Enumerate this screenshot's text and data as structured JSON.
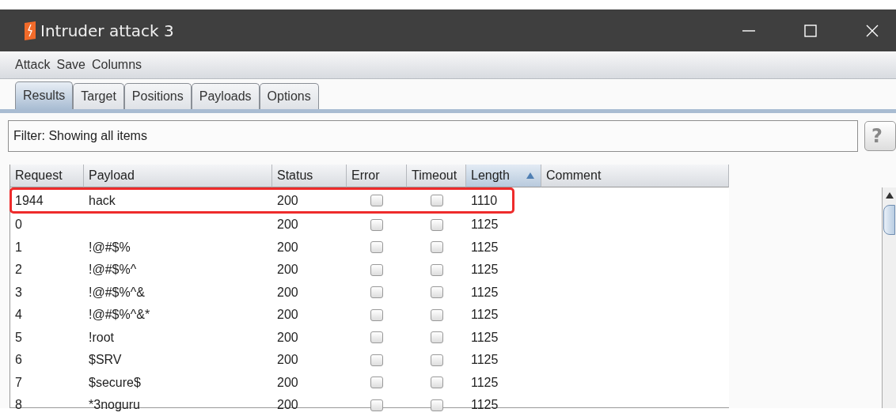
{
  "window": {
    "title": "Intruder attack 3"
  },
  "menu": [
    "Attack",
    "Save",
    "Columns"
  ],
  "tabs": [
    {
      "label": "Results",
      "selected": true
    },
    {
      "label": "Target",
      "selected": false
    },
    {
      "label": "Positions",
      "selected": false
    },
    {
      "label": "Payloads",
      "selected": false
    },
    {
      "label": "Options",
      "selected": false
    }
  ],
  "filter": {
    "value": "Filter: Showing all items",
    "help": "?"
  },
  "table": {
    "columns": [
      {
        "label": "Request",
        "sorted": false
      },
      {
        "label": "Payload",
        "sorted": false
      },
      {
        "label": "Status",
        "sorted": false
      },
      {
        "label": "Error",
        "sorted": false
      },
      {
        "label": "Timeout",
        "sorted": false
      },
      {
        "label": "Length",
        "sorted": true
      },
      {
        "label": "Comment",
        "sorted": false
      }
    ],
    "rows": [
      {
        "request": "1944",
        "payload": "hack",
        "status": "200",
        "error": false,
        "timeout": false,
        "length": "1110",
        "highlighted": true
      },
      {
        "request": "0",
        "status": "200",
        "error": false,
        "timeout": false,
        "length": "1125",
        "highlighted": false
      },
      {
        "request": "1",
        "payload": "!@#$%",
        "status": "200",
        "error": false,
        "timeout": false,
        "length": "1125",
        "highlighted": false
      },
      {
        "request": "2",
        "payload": "!@#$%^",
        "status": "200",
        "error": false,
        "timeout": false,
        "length": "1125",
        "highlighted": false
      },
      {
        "request": "3",
        "payload": "!@#$%^&",
        "status": "200",
        "error": false,
        "timeout": false,
        "length": "1125",
        "highlighted": false
      },
      {
        "request": "4",
        "payload": "!@#$%^&*",
        "status": "200",
        "error": false,
        "timeout": false,
        "length": "1125",
        "highlighted": false
      },
      {
        "request": "5",
        "payload": "!root",
        "status": "200",
        "error": false,
        "timeout": false,
        "length": "1125",
        "highlighted": false
      },
      {
        "request": "6",
        "payload": "$SRV",
        "status": "200",
        "error": false,
        "timeout": false,
        "length": "1125",
        "highlighted": false
      },
      {
        "request": "7",
        "payload": "$secure$",
        "status": "200",
        "error": false,
        "timeout": false,
        "length": "1125",
        "highlighted": false
      },
      {
        "request": "8",
        "payload": "*3noguru",
        "status": "200",
        "error": false,
        "timeout": false,
        "length": "1125",
        "highlighted": false
      }
    ]
  }
}
